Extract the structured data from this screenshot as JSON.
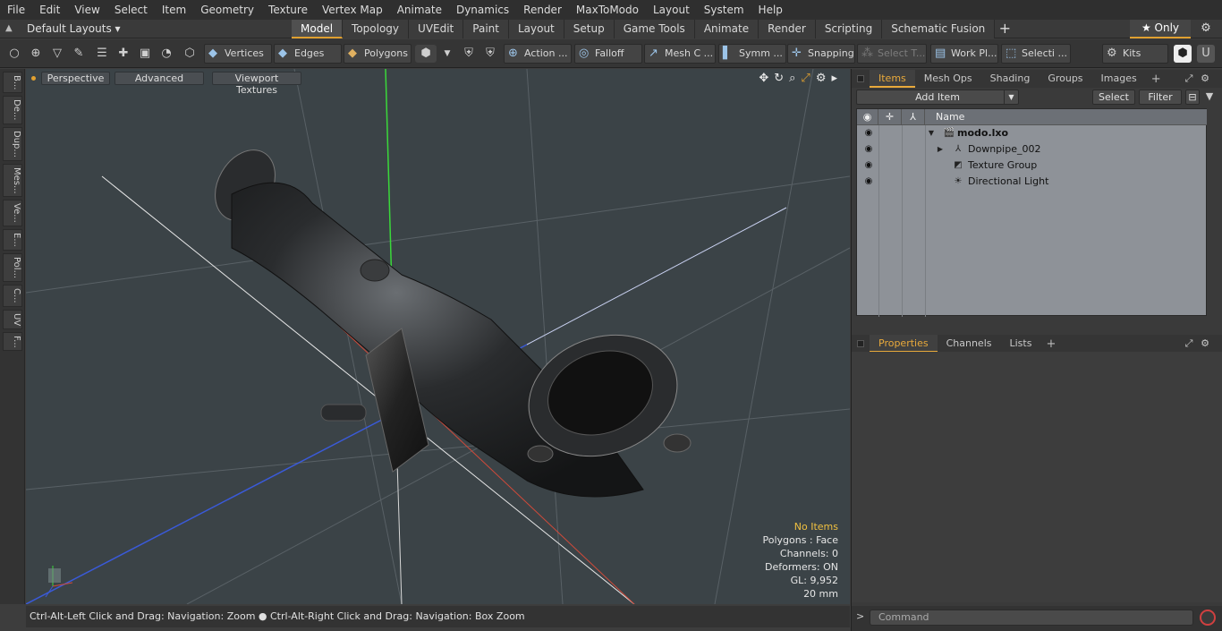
{
  "menu": [
    "File",
    "Edit",
    "View",
    "Select",
    "Item",
    "Geometry",
    "Texture",
    "Vertex Map",
    "Animate",
    "Dynamics",
    "Render",
    "MaxToModo",
    "Layout",
    "System",
    "Help"
  ],
  "layouts": {
    "dropdown": "Default Layouts ▾"
  },
  "tabs": [
    "Model",
    "Topology",
    "UVEdit",
    "Paint",
    "Layout",
    "Setup",
    "Game Tools",
    "Animate",
    "Render",
    "Scripting",
    "Schematic Fusion"
  ],
  "only_label": "★ Only",
  "toolbar": {
    "vertices": "Vertices",
    "edges": "Edges",
    "polygons": "Polygons",
    "action": "Action ...",
    "falloff": "Falloff",
    "mesh": "Mesh C ...",
    "symm": "Symm ...",
    "snapping": "Snapping",
    "select_t": "Select T...",
    "workpl": "Work Pl...",
    "selecti": "Selecti ...",
    "kits": "Kits"
  },
  "left_tabs": [
    "B...",
    "De...",
    "Dup...",
    "Mes...",
    "Ve...",
    "E...",
    "Pol...",
    "C...",
    "UV",
    "F..."
  ],
  "viewport": {
    "perspective": "Perspective",
    "advanced": "Advanced",
    "viewport_textures": "Viewport Textures",
    "info": {
      "no_items": "No Items",
      "polygons": "Polygons : Face",
      "channels": "Channels: 0",
      "deformers": "Deformers: ON",
      "gl": "GL: 9,952",
      "scale": "20 mm"
    }
  },
  "status": "Ctrl-Alt-Left Click and Drag: Navigation: Zoom ● Ctrl-Alt-Right Click and Drag: Navigation: Box Zoom",
  "items_panel": {
    "tabs": [
      "Items",
      "Mesh Ops",
      "Shading",
      "Groups",
      "Images"
    ],
    "add_item": "Add Item",
    "select": "Select",
    "filter": "Filter",
    "col_name": "Name",
    "rows": [
      {
        "label": "modo.lxo"
      },
      {
        "label": "Downpipe_002"
      },
      {
        "label": "Texture Group"
      },
      {
        "label": "Directional Light"
      }
    ]
  },
  "props_panel": {
    "tabs": [
      "Properties",
      "Channels",
      "Lists"
    ]
  },
  "command": {
    "placeholder": "Command",
    "prompt": ">"
  },
  "colors": {
    "accent": "#e8a93b",
    "viewport_bg": "#3b4347"
  }
}
